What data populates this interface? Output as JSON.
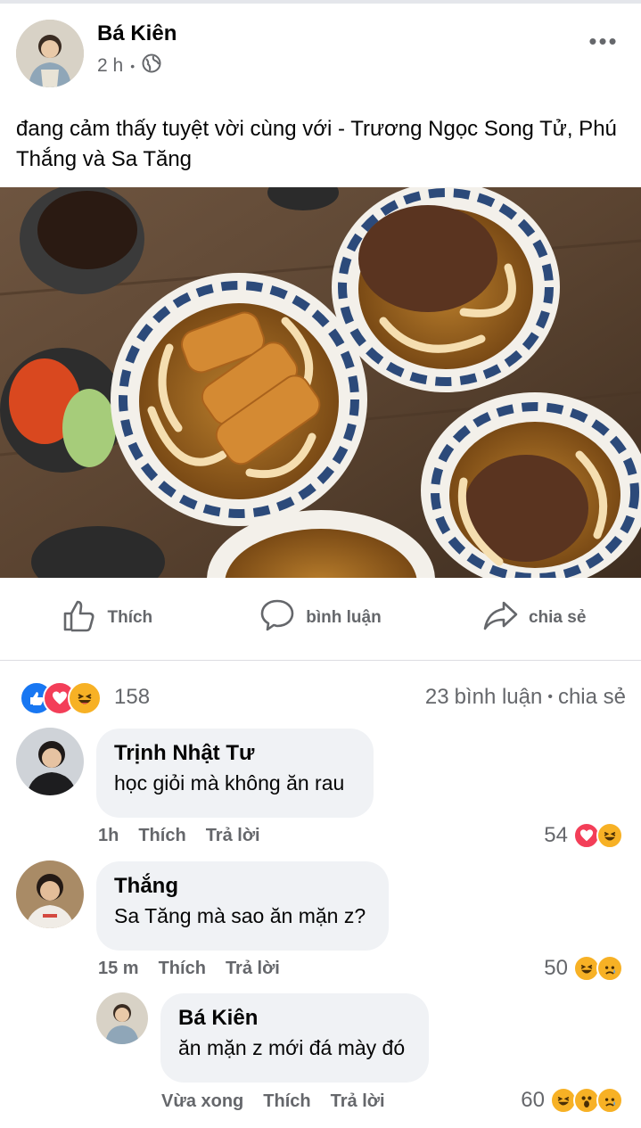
{
  "post": {
    "author": "Bá Kiên",
    "time": "2 h",
    "dot": "•",
    "more_label": "•••",
    "text": "đang cảm thấy tuyệt vời cùng với - Trương Ngọc Song Tử, Phú Thắng và Sa Tăng",
    "photo_icon": "food-photo"
  },
  "actions": {
    "like": "Thích",
    "comment": "bình luận",
    "share": "chia sẻ"
  },
  "summary": {
    "reactions": [
      "like",
      "love",
      "haha"
    ],
    "reaction_count": "158",
    "comment_count": "23",
    "comment_label": "bình luận",
    "dot": "•",
    "share_label": "chia sẻ"
  },
  "comments": [
    {
      "name": "Trịnh Nhật Tư",
      "text": "học giỏi mà không ăn rau",
      "time": "1h",
      "like": "Thích",
      "reply": "Trả lời",
      "react_count": "54",
      "reactions": [
        "love",
        "haha"
      ]
    },
    {
      "name": "Thắng",
      "text": "Sa Tăng mà sao ăn mặn z?",
      "time": "15 m",
      "like": "Thích",
      "reply": "Trả lời",
      "react_count": "50",
      "reactions": [
        "haha",
        "sad"
      ]
    },
    {
      "name": "Bá Kiên",
      "text": "ăn mặn z mới đá mày đó",
      "time": "Vừa xong",
      "like": "Thích",
      "reply": "Trả lời",
      "react_count": "60",
      "reactions": [
        "haha",
        "wow",
        "sad"
      ]
    }
  ],
  "colors": {
    "like_blue": "#1877f2",
    "love_red": "#f33e58",
    "haha_yellow": "#f7b125",
    "secondary_text": "#65676b",
    "bubble_bg": "#f0f2f5"
  }
}
